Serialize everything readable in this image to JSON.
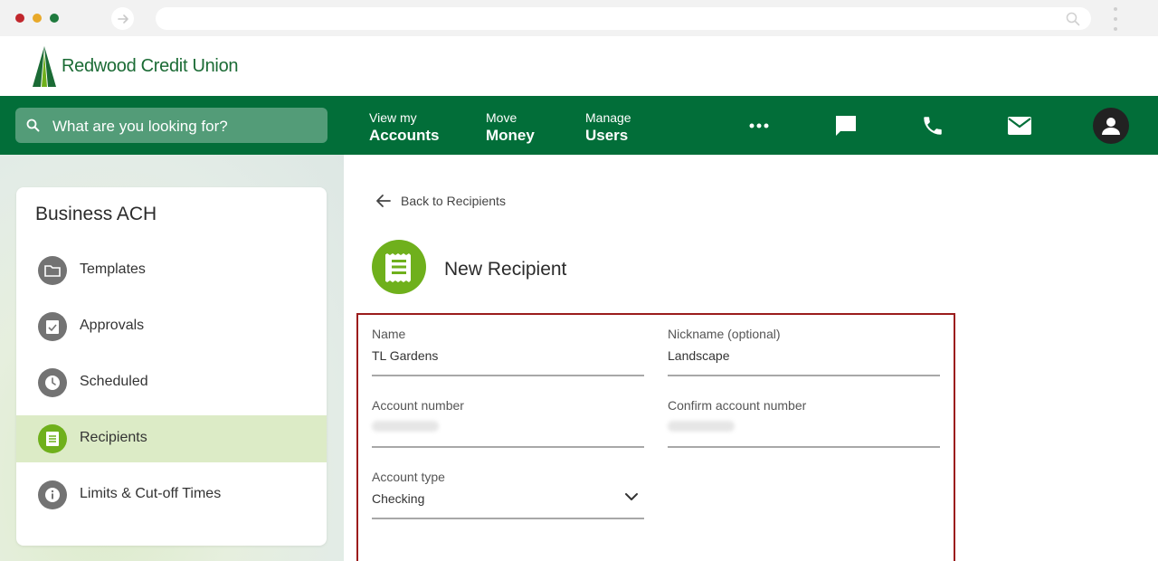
{
  "brand": {
    "name": "Redwood Credit Union",
    "color": "#026e39",
    "accent": "#6fb01c",
    "highlight_border": "#9b1c1c"
  },
  "browser": {
    "controls": [
      "back-arrow-icon",
      "forward-arrow-icon",
      "search-icon",
      "kebab-menu-icon"
    ]
  },
  "nav": {
    "search_placeholder": "What are you looking for?",
    "links": [
      {
        "line1": "View my",
        "line2": "Accounts"
      },
      {
        "line1": "Move",
        "line2": "Money"
      },
      {
        "line1": "Manage",
        "line2": "Users"
      }
    ],
    "icons": [
      "more-icon",
      "chat-icon",
      "phone-icon",
      "mail-icon",
      "user-avatar-icon"
    ]
  },
  "sidebar": {
    "title": "Business ACH",
    "items": [
      {
        "label": "Templates",
        "icon": "folder-icon",
        "active": false
      },
      {
        "label": "Approvals",
        "icon": "clipboard-check-icon",
        "active": false
      },
      {
        "label": "Scheduled",
        "icon": "clock-icon",
        "active": false
      },
      {
        "label": "Recipients",
        "icon": "receipt-icon",
        "active": true
      },
      {
        "label": "Limits & Cut-off Times",
        "icon": "info-icon",
        "active": false
      }
    ]
  },
  "main": {
    "back_label": "Back to Recipients",
    "title": "New Recipient",
    "form": {
      "name": {
        "label": "Name",
        "value": "TL Gardens"
      },
      "nickname": {
        "label": "Nickname (optional)",
        "value": "Landscape"
      },
      "account_number": {
        "label": "Account number",
        "value": ""
      },
      "confirm_account_number": {
        "label": "Confirm account number",
        "value": ""
      },
      "account_type": {
        "label": "Account type",
        "value": "Checking"
      }
    }
  }
}
